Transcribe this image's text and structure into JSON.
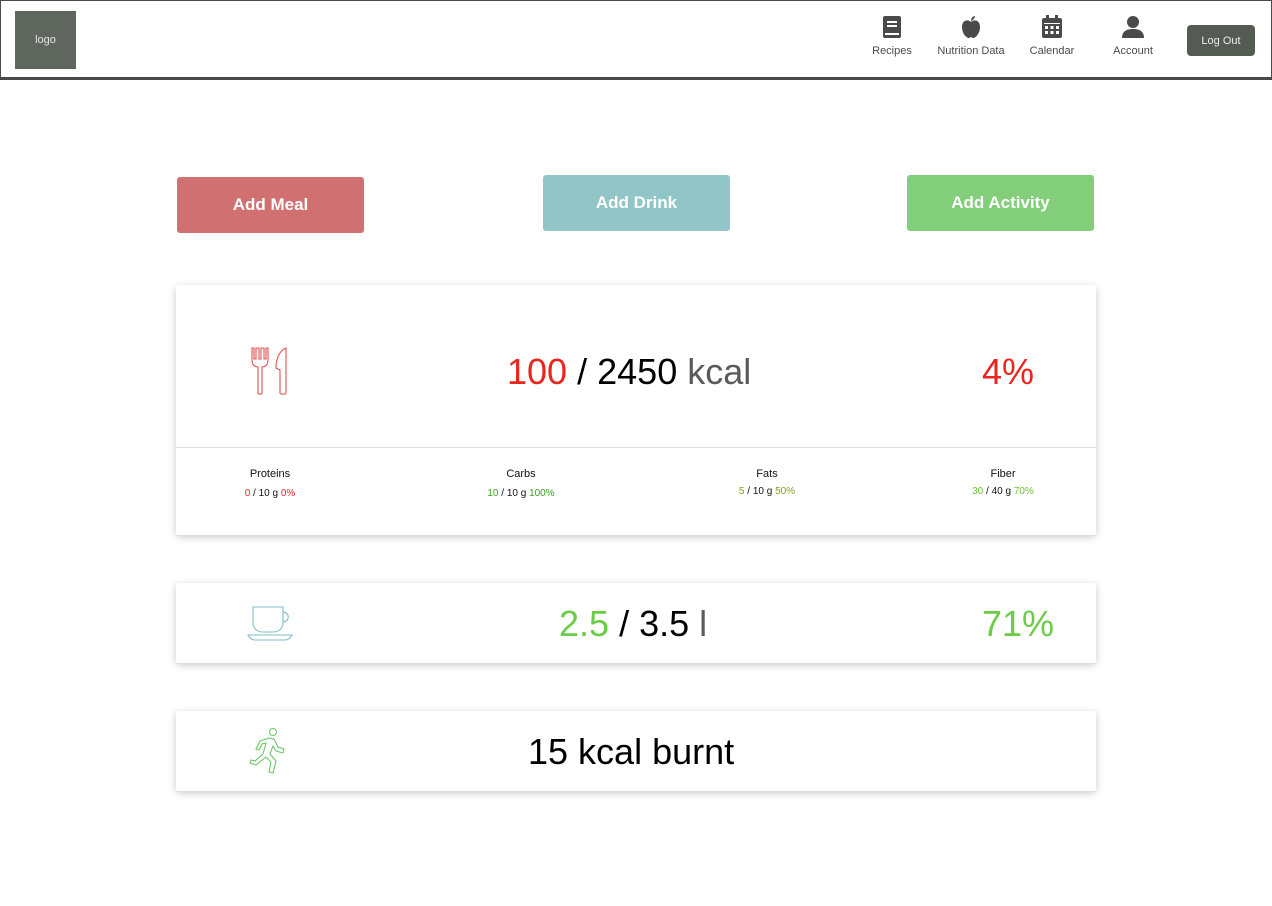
{
  "header": {
    "logo": "logo",
    "nav": [
      {
        "label": "Recipes",
        "icon": "book-icon"
      },
      {
        "label": "Nutrition Data",
        "icon": "apple-icon"
      },
      {
        "label": "Calendar",
        "icon": "calendar-icon"
      },
      {
        "label": "Account",
        "icon": "user-icon"
      }
    ],
    "logout_label": "Log Out"
  },
  "actions": {
    "add_meal": "Add Meal",
    "add_drink": "Add Drink",
    "add_activity": "Add Activity"
  },
  "meal": {
    "consumed": "100",
    "separator": "/",
    "goal": "2450",
    "unit": "kcal",
    "percent": "4%",
    "macros": [
      {
        "name": "Proteins",
        "value": "0",
        "goal": "10 g",
        "percent": "0%",
        "color": "#e8261f"
      },
      {
        "name": "Carbs",
        "value": "10",
        "goal": "10 g",
        "percent": "100%",
        "color": "#3a9f1e"
      },
      {
        "name": "Fats",
        "value": "5",
        "goal": "10 g",
        "percent": "50%",
        "color": "#8a9a1d"
      },
      {
        "name": "Fiber",
        "value": "30",
        "goal": "40 g",
        "percent": "70%",
        "color": "#6cbf3a"
      }
    ]
  },
  "drink": {
    "consumed": "2.5",
    "separator": "/",
    "goal": "3.5",
    "unit": "l",
    "percent": "71%"
  },
  "activity": {
    "burnt": "15 kcal burnt"
  },
  "colors": {
    "meal": "#d07070",
    "drink": "#92c5c8",
    "activity": "#82ce7a",
    "red": "#e8261f",
    "green": "#6ccc46",
    "gray": "#5a5a5a"
  }
}
